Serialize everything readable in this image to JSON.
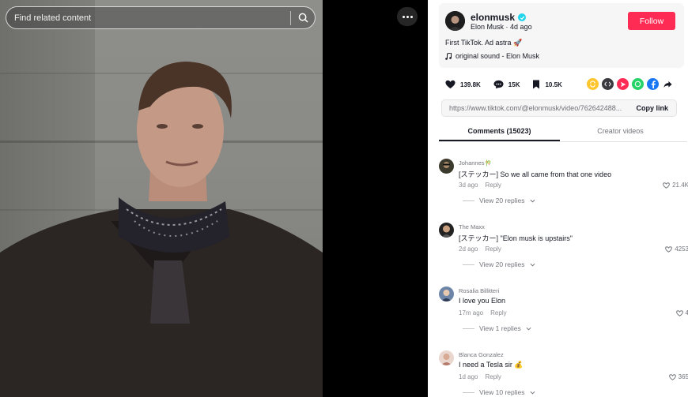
{
  "search": {
    "placeholder": "Find related content"
  },
  "author": {
    "username": "elonmusk",
    "display_name": "Elon Musk",
    "time_ago": "4d ago",
    "follow_label": "Follow",
    "caption": "First TikTok. Ad astra 🚀",
    "sound": "original sound - Elon Musk"
  },
  "stats": {
    "likes": "139.8K",
    "comments": "15K",
    "saves": "10.5K"
  },
  "share": {
    "url": "https://www.tiktok.com/@elonmusk/video/762642488...",
    "copy_label": "Copy link"
  },
  "tabs": {
    "comments": "Comments (15023)",
    "creator": "Creator videos"
  },
  "comments": [
    {
      "user": "Johannes🎋",
      "text": "[ステッカー] So we all came from that one video",
      "time": "3d ago",
      "reply": "Reply",
      "likes": "21.4K",
      "replies": "View 20 replies"
    },
    {
      "user": "The Maxx",
      "text": "[ステッカー] \"Elon musk is upstairs\"",
      "time": "2d ago",
      "reply": "Reply",
      "likes": "4253",
      "replies": "View 20 replies"
    },
    {
      "user": "Rosalia Billitteri",
      "text": "I love you Elon",
      "time": "17m ago",
      "reply": "Reply",
      "likes": "4",
      "replies": "View 1 replies"
    },
    {
      "user": "Blanca Gonzalez",
      "text": "I need a Tesla sir 💰",
      "time": "1d ago",
      "reply": "Reply",
      "likes": "365",
      "replies": "View 10 replies"
    }
  ],
  "colors": {
    "follow": "#fe2c55",
    "verified": "#20d5ec"
  }
}
